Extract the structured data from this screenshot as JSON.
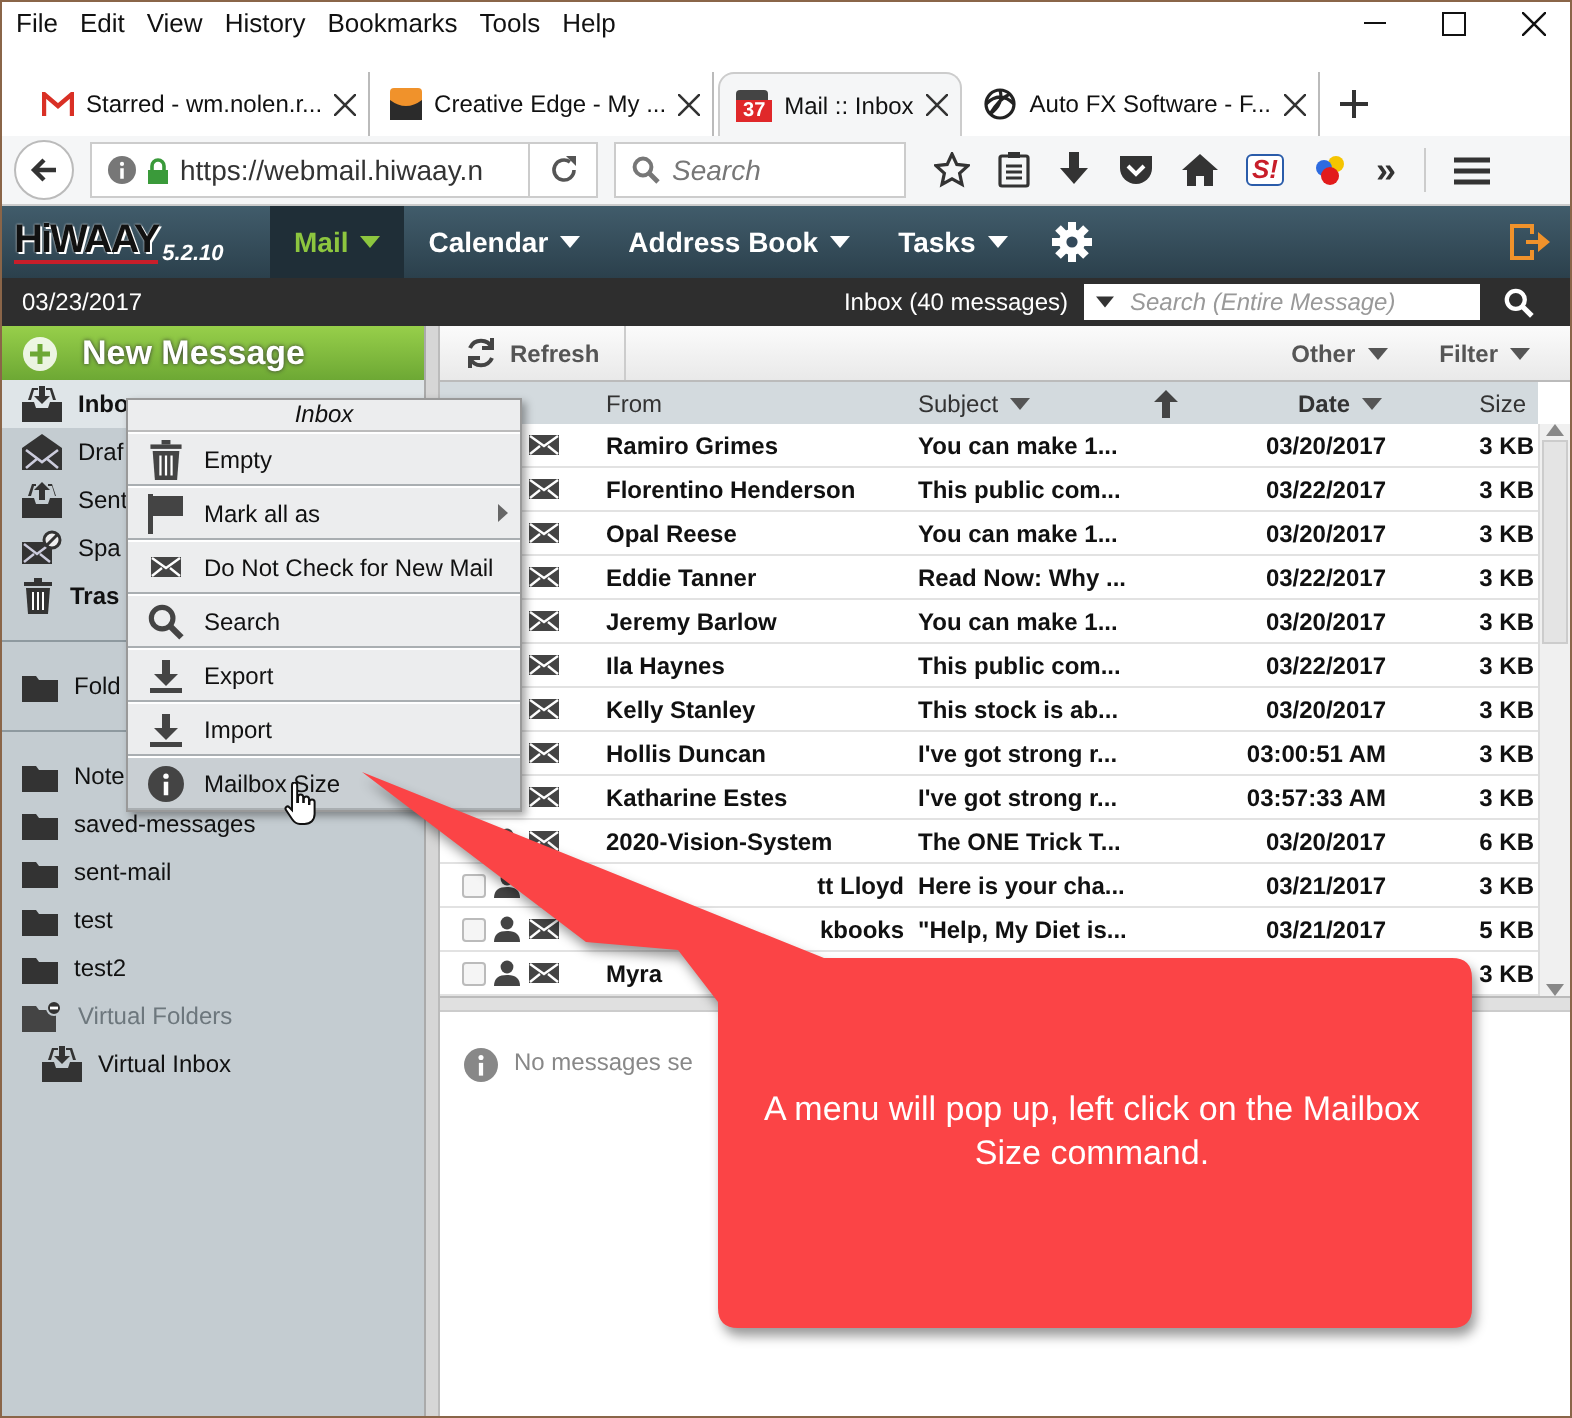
{
  "menubar": [
    "File",
    "Edit",
    "View",
    "History",
    "Bookmarks",
    "Tools",
    "Help"
  ],
  "tabs": [
    {
      "title": "Starred - wm.nolen.r...",
      "selected": false
    },
    {
      "title": "Creative Edge - My ...",
      "selected": false
    },
    {
      "title": "Mail :: Inbox",
      "badge": "37",
      "selected": true
    },
    {
      "title": "Auto FX Software - F...",
      "selected": false
    }
  ],
  "navbar": {
    "url": "https://webmail.hiwaay.n",
    "search_placeholder": "Search",
    "extension_logo": "S!",
    "overflow": "»"
  },
  "app": {
    "logo": "HiWAAY",
    "version": "5.2.10",
    "nav": [
      {
        "label": "Mail",
        "selected": true
      },
      {
        "label": "Calendar",
        "selected": false
      },
      {
        "label": "Address Book",
        "selected": false
      },
      {
        "label": "Tasks",
        "selected": false
      }
    ]
  },
  "status_bar": {
    "date": "03/23/2017",
    "mailbox": "Inbox (40 messages)",
    "search_placeholder": "Search (Entire Message)"
  },
  "sidebar": {
    "new_message": "New Message",
    "groups": [
      [
        {
          "label": "Inbo",
          "kind": "inbox",
          "bold": true,
          "selected": true
        },
        {
          "label": "Draf",
          "kind": "drafts",
          "bold": false,
          "selected": false
        },
        {
          "label": "Sent",
          "kind": "sent",
          "bold": false,
          "selected": false
        },
        {
          "label": "Spa",
          "kind": "spam",
          "bold": false,
          "selected": false
        },
        {
          "label": "Tras",
          "kind": "trash",
          "bold": true,
          "selected": false
        }
      ],
      [
        {
          "label": "Fold",
          "kind": "folder",
          "bold": false,
          "selected": false
        }
      ],
      [
        {
          "label": "Note",
          "kind": "folder",
          "bold": false,
          "selected": false
        },
        {
          "label": "saved-messages",
          "kind": "folder",
          "bold": false,
          "selected": false
        },
        {
          "label": "sent-mail",
          "kind": "folder",
          "bold": false,
          "selected": false
        },
        {
          "label": "test",
          "kind": "folder",
          "bold": false,
          "selected": false
        },
        {
          "label": "test2",
          "kind": "folder",
          "bold": false,
          "selected": false
        },
        {
          "label": "Virtual Folders",
          "kind": "virtual",
          "bold": false,
          "selected": false,
          "children": [
            {
              "label": "Virtual Inbox",
              "kind": "inbox",
              "bold": false,
              "selected": false
            }
          ]
        }
      ]
    ]
  },
  "context_menu": {
    "title": "Inbox",
    "items": [
      {
        "label": "Empty",
        "submenu": false,
        "selected": false
      },
      {
        "label": "Mark all as",
        "submenu": true,
        "selected": false
      },
      {
        "label": "Do Not Check for New Mail",
        "submenu": false,
        "selected": false
      },
      {
        "label": "Search",
        "submenu": false,
        "selected": false
      },
      {
        "label": "Export",
        "submenu": false,
        "selected": false
      },
      {
        "label": "Import",
        "submenu": false,
        "selected": false
      },
      {
        "label": "Mailbox Size",
        "submenu": false,
        "selected": true
      }
    ]
  },
  "toolbar": {
    "refresh": "Refresh",
    "other": "Other",
    "filter": "Filter"
  },
  "table": {
    "columns": [
      {
        "label": "From",
        "sorted": false,
        "caret": false
      },
      {
        "label": "Subject",
        "sorted": false,
        "caret": true
      },
      {
        "label": "Date",
        "sorted": true,
        "caret": true
      },
      {
        "label": "Size",
        "sorted": false,
        "caret": false
      }
    ],
    "rows": [
      {
        "kind": "covered",
        "from": "Ramiro Grimes",
        "from_cut": false,
        "subject": "You can make 1...",
        "date": "03/20/2017",
        "size": "3 KB"
      },
      {
        "kind": "covered",
        "from": "Florentino Henderson",
        "from_cut": false,
        "subject": "This public com...",
        "date": "03/22/2017",
        "size": "3 KB"
      },
      {
        "kind": "covered",
        "from": "Opal Reese",
        "from_cut": false,
        "subject": "You can make 1...",
        "date": "03/20/2017",
        "size": "3 KB"
      },
      {
        "kind": "covered",
        "from": "Eddie Tanner",
        "from_cut": false,
        "subject": "Read Now: Why ...",
        "date": "03/22/2017",
        "size": "3 KB"
      },
      {
        "kind": "covered",
        "from": "Jeremy Barlow",
        "from_cut": false,
        "subject": "You can make 1...",
        "date": "03/20/2017",
        "size": "3 KB"
      },
      {
        "kind": "covered",
        "from": "Ila Haynes",
        "from_cut": false,
        "subject": "This public com...",
        "date": "03/22/2017",
        "size": "3 KB"
      },
      {
        "kind": "covered",
        "from": "Kelly Stanley",
        "from_cut": false,
        "subject": "This stock is ab...",
        "date": "03/20/2017",
        "size": "3 KB"
      },
      {
        "kind": "covered",
        "from": "Hollis Duncan",
        "from_cut": false,
        "subject": "I've got strong r...",
        "date": "03:00:51 AM",
        "size": "3 KB"
      },
      {
        "kind": "covered",
        "from": "Katharine Estes",
        "from_cut": false,
        "subject": "I've got strong r...",
        "date": "03:57:33 AM",
        "size": "3 KB"
      },
      {
        "kind": "partial",
        "from": "2020-Vision-System",
        "from_cut": false,
        "subject": "The ONE Trick T...",
        "date": "03/20/2017",
        "size": "6 KB"
      },
      {
        "kind": "no_mail",
        "checked": false,
        "from": "tt Lloyd",
        "from_cut": true,
        "subject": "Here is your cha...",
        "date": "03/21/2017",
        "size": "3 KB"
      },
      {
        "kind": "full",
        "checked": false,
        "from": "kbooks",
        "from_cut": true,
        "subject": "\"Help, My Diet is...",
        "date": "03/21/2017",
        "size": "5 KB"
      },
      {
        "kind": "full",
        "checked": false,
        "from": "Myra",
        "from_cut": false,
        "size": "3 KB"
      }
    ]
  },
  "preview": {
    "message": "No messages se"
  },
  "callout": {
    "text": "A menu will pop up, left click on the Mailbox Size command."
  }
}
